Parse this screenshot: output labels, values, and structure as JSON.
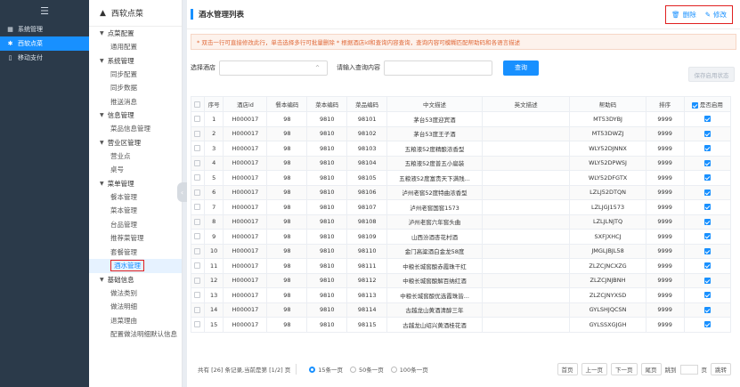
{
  "nav1": {
    "items": [
      {
        "label": "系统管理",
        "icon": "grid-icon"
      },
      {
        "label": "西软点菜",
        "icon": "star-icon"
      },
      {
        "label": "移动支付",
        "icon": "phone-icon"
      }
    ]
  },
  "nav2": {
    "head": "西软点菜",
    "groups": [
      {
        "label": "点菜配置",
        "subs": [
          "通用配置"
        ]
      },
      {
        "label": "系统管理",
        "subs": [
          "同步配置",
          "同步数据",
          "推送消息"
        ]
      },
      {
        "label": "信息管理",
        "subs": [
          "菜品信息管理"
        ]
      },
      {
        "label": "营业区管理",
        "subs": [
          "营业点",
          "桌号"
        ]
      },
      {
        "label": "菜单管理",
        "subs": [
          "餐本管理",
          "菜本管理",
          "台品管理",
          "推荐菜管理",
          "套餐管理",
          "酒水管理"
        ]
      },
      {
        "label": "基础信息",
        "subs": [
          "做法类别",
          "做法明细",
          "退菜理由",
          "配置做法明细默认信息"
        ]
      }
    ]
  },
  "main": {
    "title": "酒水管理列表",
    "delete_label": "删除",
    "edit_label": "修改",
    "tip": "* 双击一行可直接修改此行，单击选择多行可批量删除    * 根据酒店id和查询内容查询，查询内容可模糊匹配帮助码和各语言描述",
    "hotel_label": "选择酒店",
    "query_label": "请输入查询内容",
    "query_button": "查询",
    "save_button": "保存启用状态"
  },
  "table": {
    "headers": [
      "序号",
      "酒店id",
      "餐本编码",
      "菜本编码",
      "菜品编码",
      "中文描述",
      "英文描述",
      "帮助码",
      "排序",
      "是否启用"
    ],
    "rows": [
      [
        "1",
        "H000017",
        "98",
        "9810",
        "98101",
        "茅台53度迎宾酒",
        "",
        "MT53DYBJ",
        "9999"
      ],
      [
        "2",
        "H000017",
        "98",
        "9810",
        "98102",
        "茅台53度王子酒",
        "",
        "MT53DWZJ",
        "9999"
      ],
      [
        "3",
        "H000017",
        "98",
        "9810",
        "98103",
        "五粮液52度精酿浓香型",
        "",
        "WLY52DJNNX",
        "9999"
      ],
      [
        "4",
        "H000017",
        "98",
        "9810",
        "98104",
        "五粮液52度普五小扁装",
        "",
        "WLY52DPWSJ",
        "9999"
      ],
      [
        "5",
        "H000017",
        "98",
        "9810",
        "98105",
        "五粮液52度富贵天下满残...",
        "",
        "WLY52DFGTX",
        "9999"
      ],
      [
        "6",
        "H000017",
        "98",
        "9810",
        "98106",
        "泸州老窖52度特曲浓香型",
        "",
        "LZLJ52DTQN",
        "9999"
      ],
      [
        "7",
        "H000017",
        "98",
        "9810",
        "98107",
        "泸州老窖国窖1573",
        "",
        "LZLJGJ1573",
        "9999"
      ],
      [
        "8",
        "H000017",
        "98",
        "9810",
        "98108",
        "泸州老窖六年窖头曲",
        "",
        "LZLJLNJTQ",
        "9999"
      ],
      [
        "9",
        "H000017",
        "98",
        "9810",
        "98109",
        "山西汾酒杏花村酒",
        "",
        "SXFJXHCJ",
        "9999"
      ],
      [
        "10",
        "H000017",
        "98",
        "9810",
        "98110",
        "金门高粱酒白金龙58度",
        "",
        "JMGLJBJL58",
        "9999"
      ],
      [
        "11",
        "H000017",
        "98",
        "9810",
        "98111",
        "中粮长城窖酿赤霞珠干红",
        "",
        "ZLZCJNCXZG",
        "9999"
      ],
      [
        "12",
        "H000017",
        "98",
        "9810",
        "98112",
        "中粮长城窖酿解百纳红酒",
        "",
        "ZLZCJNJBNH",
        "9999"
      ],
      [
        "13",
        "H000017",
        "98",
        "9810",
        "98113",
        "中粮长城窖酿优选霞珠皆...",
        "",
        "ZLZCJNYXSD",
        "9999"
      ],
      [
        "14",
        "H000017",
        "98",
        "9810",
        "98114",
        "古越龙山黄酒清醇三年",
        "",
        "GYLSHJQCSN",
        "9999"
      ],
      [
        "15",
        "H000017",
        "98",
        "9810",
        "98115",
        "古越龙山绍兴黄酒桂花酒",
        "",
        "GYLSSXGJGH",
        "9999"
      ]
    ]
  },
  "footer": {
    "summary": "共有 [26] 条记录,当前是第 [1/2] 页",
    "opt15": "15条一页",
    "opt50": "50条一页",
    "opt100": "100条一页",
    "first": "首页",
    "prev": "上一页",
    "next": "下一页",
    "last": "尾页",
    "goto": "跳到",
    "page": "页",
    "jump": "跳转"
  }
}
